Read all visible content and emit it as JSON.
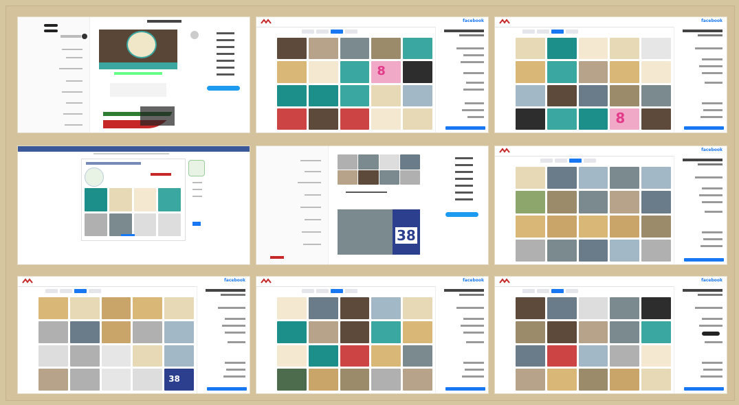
{
  "panels": [
    {
      "id": "panel-1",
      "brand": "",
      "overlay_text": ""
    },
    {
      "id": "panel-2",
      "brand": "facebook",
      "overlay_text": "8"
    },
    {
      "id": "panel-3",
      "brand": "facebook",
      "overlay_text": "8"
    },
    {
      "id": "panel-4",
      "brand": "",
      "overlay_text": ""
    },
    {
      "id": "panel-5",
      "brand": "",
      "overlay_text": "38"
    },
    {
      "id": "panel-6",
      "brand": "facebook",
      "overlay_text": ""
    },
    {
      "id": "panel-7",
      "brand": "facebook",
      "overlay_text": "38"
    },
    {
      "id": "panel-8",
      "brand": "facebook",
      "overlay_text": ""
    },
    {
      "id": "panel-9",
      "brand": "facebook",
      "overlay_text": ""
    }
  ],
  "colors": {
    "background": "#d6c6a0",
    "accent": "#1877f2",
    "purple": "#6f2c91"
  }
}
